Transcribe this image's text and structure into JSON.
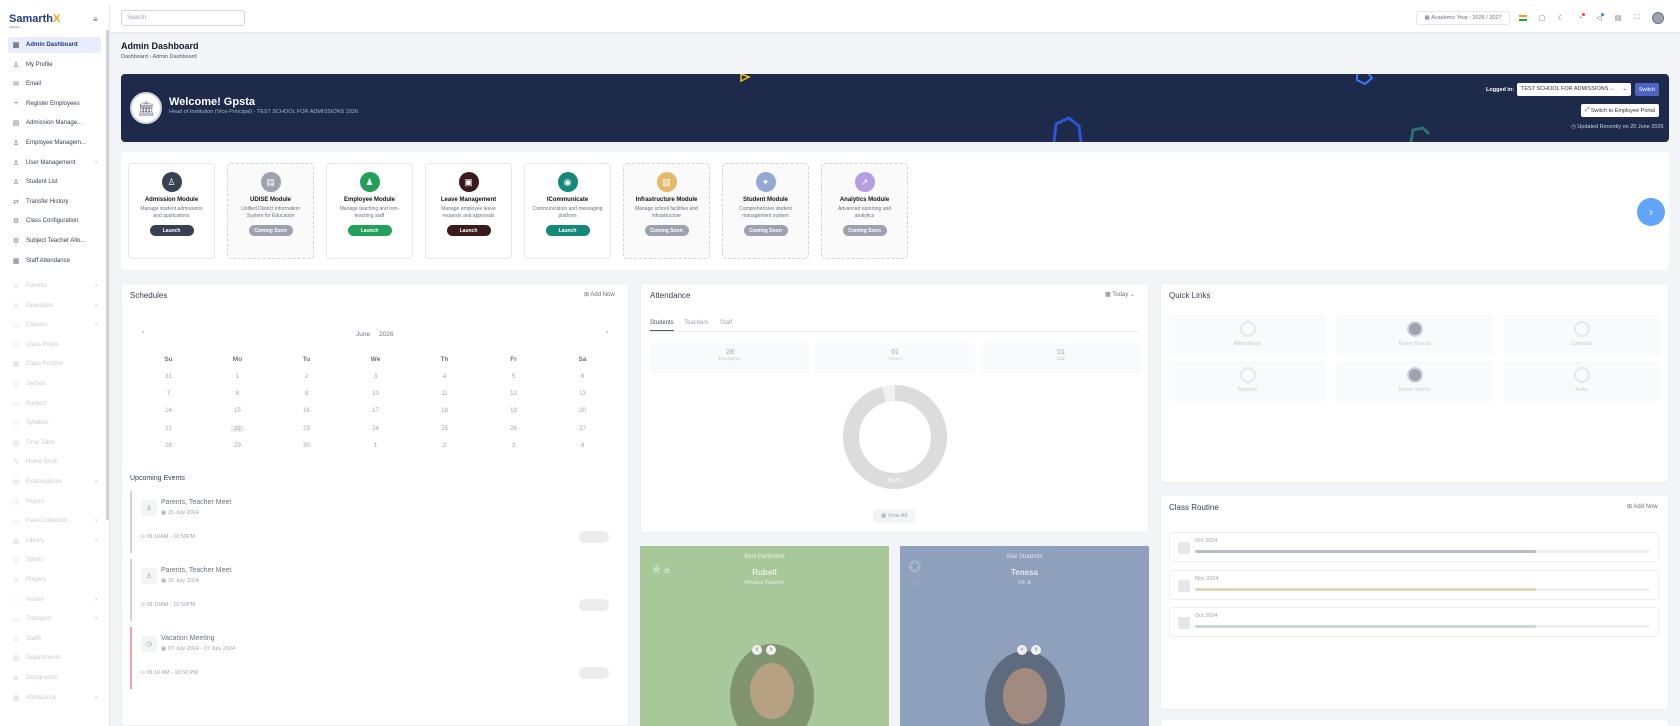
{
  "app": {
    "logo_main": "Samarth",
    "logo_accent": "X",
    "logo_sub": "Shiksha"
  },
  "sidebar": {
    "items": [
      {
        "label": "Admin Dashboard",
        "icon": "grid-icon",
        "active": true
      },
      {
        "label": "My Profile",
        "icon": "user-icon"
      },
      {
        "label": "Email",
        "icon": "mail-icon"
      },
      {
        "label": "Register Employees",
        "icon": "plus-icon"
      },
      {
        "label": "Admission Manage...",
        "icon": "clipboard-icon"
      },
      {
        "label": "Employee Managem...",
        "icon": "users-icon"
      },
      {
        "label": "User Management",
        "icon": "users-icon",
        "chevron": true
      },
      {
        "label": "Student List",
        "icon": "users-icon"
      },
      {
        "label": "Transfer History",
        "icon": "transfer-icon"
      },
      {
        "label": "Class Configuration",
        "icon": "gear-icon"
      },
      {
        "label": "Subject Teacher Allo...",
        "icon": "gear-icon"
      },
      {
        "label": "Staff Attendance",
        "icon": "calendar-icon"
      },
      {
        "label": "Parents",
        "icon": "user-icon",
        "chevron": true,
        "faded": true
      },
      {
        "label": "Guardians",
        "icon": "user-icon",
        "chevron": true,
        "faded": true
      },
      {
        "label": "Classes",
        "icon": "book-icon",
        "chevron": true,
        "faded": true
      },
      {
        "label": "Class Room",
        "icon": "room-icon",
        "faded": true
      },
      {
        "label": "Class Routine",
        "icon": "calendar-icon",
        "faded": true
      },
      {
        "label": "Section",
        "icon": "section-icon",
        "faded": true
      },
      {
        "label": "Subject",
        "icon": "book-icon",
        "faded": true
      },
      {
        "label": "Syllabus",
        "icon": "book-icon",
        "faded": true
      },
      {
        "label": "Time Table",
        "icon": "table-icon",
        "faded": true
      },
      {
        "label": "Home Work",
        "icon": "pencil-icon",
        "faded": true
      },
      {
        "label": "Examinations",
        "icon": "exam-icon",
        "chevron": true,
        "faded": true
      },
      {
        "label": "Report",
        "icon": "report-icon",
        "faded": true
      },
      {
        "label": "Fees Collection",
        "icon": "money-icon",
        "chevron": true,
        "faded": true
      },
      {
        "label": "Library",
        "icon": "library-icon",
        "chevron": true,
        "faded": true
      },
      {
        "label": "Sports",
        "icon": "sports-icon",
        "faded": true
      },
      {
        "label": "Players",
        "icon": "user-icon",
        "faded": true
      },
      {
        "label": "Hostel",
        "icon": "hostel-icon",
        "chevron": true,
        "faded": true
      },
      {
        "label": "Transport",
        "icon": "bus-icon",
        "chevron": true,
        "faded": true
      },
      {
        "label": "Staffs",
        "icon": "users-icon",
        "faded": true
      },
      {
        "label": "Departments",
        "icon": "building-icon",
        "faded": true
      },
      {
        "label": "Designation",
        "icon": "badge-icon",
        "faded": true
      },
      {
        "label": "Attendance",
        "icon": "calendar-icon",
        "chevron": true,
        "faded": true
      }
    ]
  },
  "header": {
    "search_placeholder": "Search",
    "academic_year": "Academic Year : 2026 / 2027"
  },
  "page": {
    "title": "Admin Dashboard",
    "crumb_1": "Dashboard",
    "crumb_2": "Admin Dashboard"
  },
  "banner": {
    "welcome": "Welcome! Gpsta",
    "subtitle": "Head of Institution (Vice-Principal) - TEST SCHOOL FOR ADMISSIONS 2026",
    "logged_in_label": "Logged in:",
    "school": "TEST SCHOOL FOR ADMISSIONS ...",
    "switch_label": "Switch",
    "portal_label": "Switch to Employee Portal",
    "updated": "Updated Recently on 20 June 2026"
  },
  "modules": [
    {
      "title": "Admission Module",
      "desc": "Manage student admissions and applications",
      "button": "Launch",
      "color": "#374151",
      "btn_color": "#374151",
      "soon": false
    },
    {
      "title": "UDISE Module",
      "desc": "Unified District Information System for Education",
      "button": "Coming Soon",
      "color": "#9ca3af",
      "btn_color": "#9ca3af",
      "soon": true
    },
    {
      "title": "Employee Module",
      "desc": "Manage teaching and non-teaching staff",
      "button": "Launch",
      "color": "#22a05a",
      "btn_color": "#22a05a",
      "soon": false
    },
    {
      "title": "Leave Management",
      "desc": "Manage employee leave requests and approvals",
      "button": "Launch",
      "color": "#3b1a1a",
      "btn_color": "#3b1a1a",
      "soon": false
    },
    {
      "title": "ICommunicate",
      "desc": "Communication and messaging platform",
      "button": "Launch",
      "color": "#14897a",
      "btn_color": "#14897a",
      "soon": false
    },
    {
      "title": "Infrastructure Module",
      "desc": "Manage school facilities and infrastructure",
      "button": "Coming Soon",
      "color": "#e6b86a",
      "btn_color": "#9ca3af",
      "soon": true
    },
    {
      "title": "Student Module",
      "desc": "Comprehensive student management system",
      "button": "Coming Soon",
      "color": "#93a8d4",
      "btn_color": "#9ca3af",
      "soon": true
    },
    {
      "title": "Analytics Module",
      "desc": "Advanced reporting and analytics",
      "button": "Coming Soon",
      "color": "#b59ee0",
      "btn_color": "#9ca3af",
      "soon": true
    }
  ],
  "schedules": {
    "title": "Schedules",
    "add_now": "Add Now",
    "month": "June",
    "year": "2026",
    "weekdays": [
      "Su",
      "Mo",
      "Tu",
      "We",
      "Th",
      "Fr",
      "Sa"
    ],
    "weeks": [
      [
        "31",
        "1",
        "2",
        "3",
        "4",
        "5",
        "6"
      ],
      [
        "7",
        "8",
        "9",
        "10",
        "11",
        "12",
        "13"
      ],
      [
        "14",
        "15",
        "16",
        "17",
        "18",
        "19",
        "20"
      ],
      [
        "21",
        "22",
        "23",
        "24",
        "25",
        "26",
        "27"
      ],
      [
        "28",
        "29",
        "30",
        "1",
        "2",
        "3",
        "4"
      ]
    ],
    "upcoming_title": "Upcoming Events",
    "events": [
      {
        "title": "Parents, Teacher Meet",
        "date": "15 July 2024",
        "time": "09:10AM - 10:50PM"
      },
      {
        "title": "Parents, Teacher Meet",
        "date": "15 July 2024",
        "time": "09:10AM - 10:50PM"
      },
      {
        "title": "Vacation Meeting",
        "date": "07 July 2024 - 07 July 2024",
        "time": "09:10 AM - 10:50 PM"
      }
    ]
  },
  "attendance": {
    "title": "Attendance",
    "filter": "Today",
    "tabs": [
      "Students",
      "Teachers",
      "Staff"
    ],
    "stats": [
      {
        "num": "28",
        "label": "Emergency"
      },
      {
        "num": "01",
        "label": "Absent"
      },
      {
        "num": "01",
        "label": "Late"
      }
    ],
    "donut_label": "95.8%",
    "view_all": "View All",
    "present_fraction": 0.958
  },
  "performers": [
    {
      "title": "Best Performer",
      "name": "Rubell",
      "role": "Physics Teacher",
      "bg": "#a8c89a"
    },
    {
      "title": "Star Students",
      "name": "Tenesa",
      "role": "XII, A",
      "bg": "#8ea0bb"
    }
  ],
  "quick_links": {
    "title": "Quick Links",
    "items": [
      {
        "label": "Attendance",
        "dark": false
      },
      {
        "label": "Exam Result",
        "dark": true
      },
      {
        "label": "Calendar",
        "dark": false
      },
      {
        "label": "Reports",
        "dark": false
      },
      {
        "label": "Home Works",
        "dark": true
      },
      {
        "label": "Fees",
        "dark": false
      }
    ]
  },
  "class_routine": {
    "title": "Class Routine",
    "add_now": "Add Now",
    "items": [
      {
        "label": "Oct 2024",
        "progress": 0.75,
        "color": "#b8bcc4"
      },
      {
        "label": "Nov 2024",
        "progress": 0.75,
        "color": "#ddd9b8"
      },
      {
        "label": "Oct 2024",
        "progress": 0.75,
        "color": "#c7dccf"
      }
    ]
  }
}
